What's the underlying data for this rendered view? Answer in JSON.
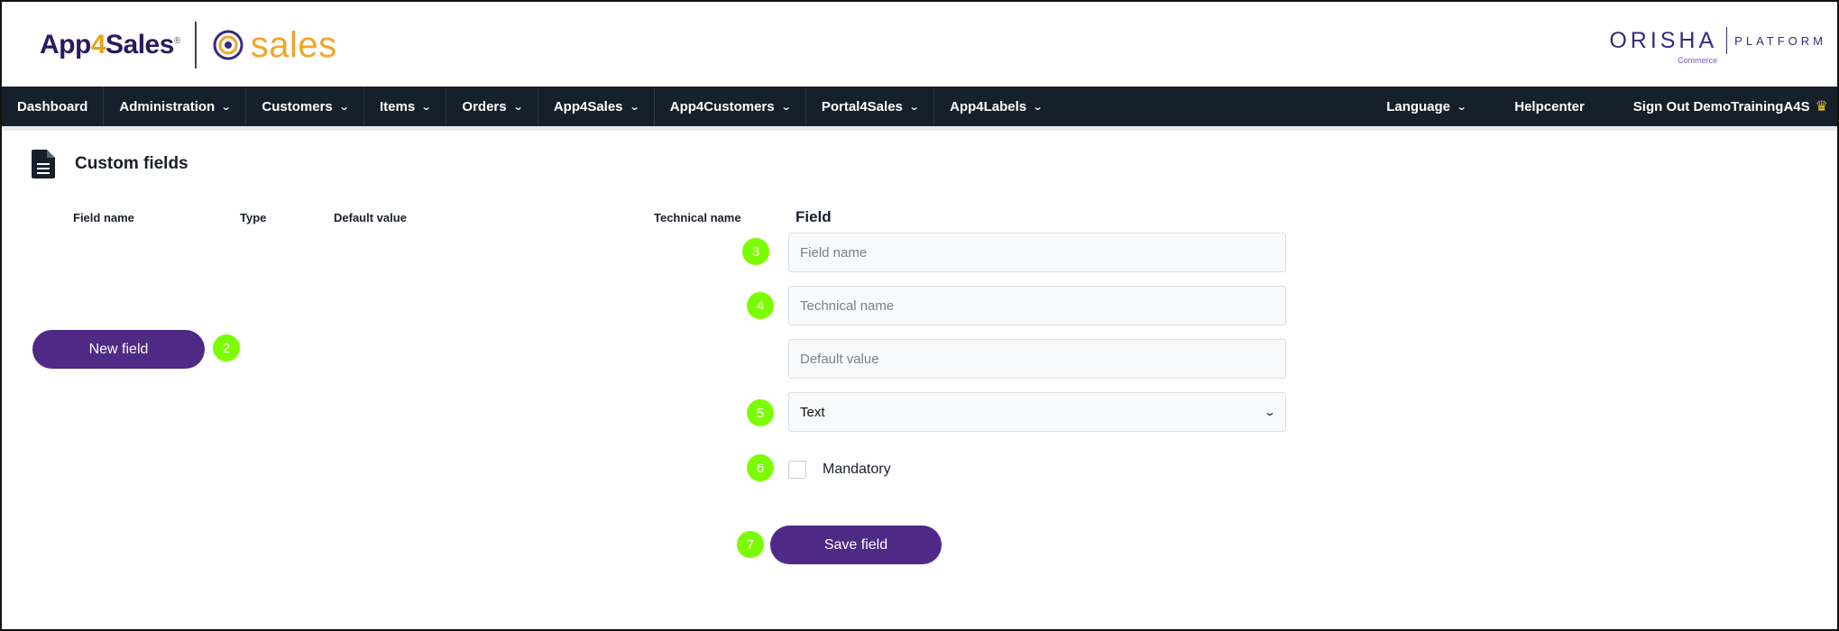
{
  "header": {
    "brand_prefix": "App",
    "brand_four": "4",
    "brand_suffix": "Sales",
    "brand_mark": "®",
    "product_name": "sales",
    "partner_name": "ORISHA",
    "partner_sub": "Commerce",
    "partner_platform": "PLATFORM"
  },
  "nav": {
    "items": [
      {
        "label": "Dashboard",
        "dropdown": false
      },
      {
        "label": "Administration",
        "dropdown": true
      },
      {
        "label": "Customers",
        "dropdown": true
      },
      {
        "label": "Items",
        "dropdown": true
      },
      {
        "label": "Orders",
        "dropdown": true
      },
      {
        "label": "App4Sales",
        "dropdown": true
      },
      {
        "label": "App4Customers",
        "dropdown": true
      },
      {
        "label": "Portal4Sales",
        "dropdown": true
      },
      {
        "label": "App4Labels",
        "dropdown": true
      }
    ],
    "language": "Language",
    "helpcenter": "Helpcenter",
    "signout_prefix": "Sign Out",
    "username": "DemoTrainingA4S",
    "crown_icon": "crown-icon",
    "colors": {
      "bar": "#16202b",
      "text": "#ffffff"
    }
  },
  "page": {
    "title": "Custom fields",
    "icon": "document-icon"
  },
  "table": {
    "columns": [
      "Field name",
      "Type",
      "Default value",
      "Technical name"
    ]
  },
  "new_field_button": "New field",
  "form": {
    "heading": "Field",
    "field_name_placeholder": "Field name",
    "technical_name_placeholder": "Technical name",
    "default_value_placeholder": "Default value",
    "type_selected": "Text",
    "mandatory_label": "Mandatory",
    "mandatory_checked": false,
    "save_label": "Save field"
  },
  "badges": {
    "b2": "2",
    "b3": "3",
    "b4": "4",
    "b5": "5",
    "b6": "6",
    "b7": "7",
    "color": "#7cfc00"
  },
  "accent_color": "#4e2a86"
}
